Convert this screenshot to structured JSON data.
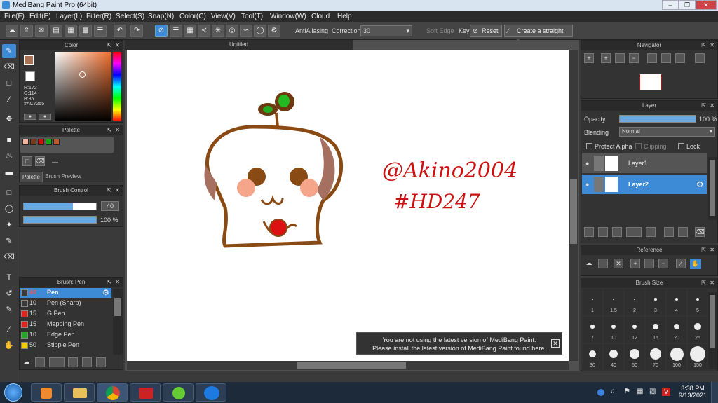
{
  "window": {
    "title": "MediBang Paint Pro (64bit)"
  },
  "menu": [
    "File(F)",
    "Edit(E)",
    "Layer(L)",
    "Filter(R)",
    "Select(S)",
    "Snap(N)",
    "Color(C)",
    "View(V)",
    "Tool(T)",
    "Window(W)",
    "Cloud",
    "Help"
  ],
  "toolbar": {
    "antialias_label": "AntiAliasing",
    "correction_label": "Correction",
    "correction_value": "30",
    "soft_edge_label": "Soft Edge",
    "key_label": "Key",
    "reset_label": "Reset",
    "straight_line_label": "Create a straight line"
  },
  "color_panel": {
    "title": "Color",
    "r": "R:172",
    "g": "G:114",
    "b": "B:85",
    "hex": "#AC7255",
    "primary_color": "#AC7255"
  },
  "palette_panel": {
    "title": "Palette",
    "dash": "---",
    "tab_palette": "Palette",
    "tab_preview": "Brush Preview",
    "swatches": [
      "#f2b49a",
      "#7a3a1a",
      "#cc1111",
      "#11aa11",
      "#c05a30"
    ]
  },
  "brush_control": {
    "title": "Brush Control",
    "size": "40",
    "opacity": "100 %",
    "size_fraction": 0.68,
    "opacity_fraction": 1.0
  },
  "brush_list": {
    "title": "Brush: Pen",
    "items": [
      {
        "size": "40",
        "name": "Pen",
        "color": "#3a3a3a"
      },
      {
        "size": "10",
        "name": "Pen (Sharp)",
        "color": "#3a3a3a"
      },
      {
        "size": "15",
        "name": "G Pen",
        "color": "#dd2222"
      },
      {
        "size": "15",
        "name": "Mapping Pen",
        "color": "#dd2222"
      },
      {
        "size": "10",
        "name": "Edge Pen",
        "color": "#22aa22"
      },
      {
        "size": "50",
        "name": "Stipple Pen",
        "color": "#eecc00"
      }
    ]
  },
  "canvas": {
    "tab_title": "Untitled"
  },
  "drawing": {
    "handle": "@Akino2004",
    "hashtag": "#HD247"
  },
  "notification": {
    "line1": "You are not using the latest version of MediBang Paint.",
    "line2": "Please install the latest version of MediBang Paint found here."
  },
  "navigator": {
    "title": "Navigator"
  },
  "layer_panel": {
    "title": "Layer",
    "opacity_label": "Opacity",
    "opacity_value": "100 %",
    "blending_label": "Blending",
    "blending_value": "Normal",
    "protect_alpha": "Protect Alpha",
    "clipping": "Clipping",
    "lock": "Lock",
    "layers": [
      {
        "name": "Layer1"
      },
      {
        "name": "Layer2"
      }
    ]
  },
  "reference": {
    "title": "Reference"
  },
  "brush_size": {
    "title": "Brush Size",
    "sizes": [
      "1",
      "1.5",
      "2",
      "3",
      "4",
      "5",
      "7",
      "10",
      "12",
      "15",
      "20",
      "25",
      "30",
      "40",
      "50",
      "70",
      "100",
      "150"
    ]
  },
  "taskbar": {
    "time": "3:38 PM",
    "date": "9/13/2021"
  }
}
